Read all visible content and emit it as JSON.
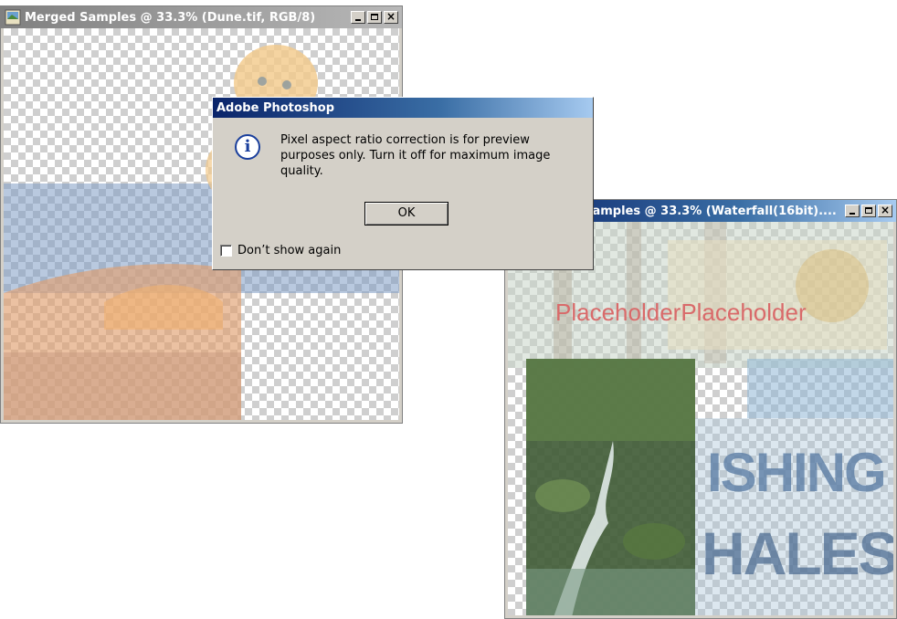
{
  "window1": {
    "title": "Merged Samples @ 33.3% (Dune.tif, RGB/8)",
    "controls": {
      "minimize": "_",
      "maximize": "□",
      "close": "✕"
    }
  },
  "window2": {
    "title": "Merged Samples @ 33.3% (Waterfall(16bit)....",
    "controls": {
      "minimize": "_",
      "maximize": "□",
      "close": "✕"
    },
    "overlay_text_1": "PlaceholderPlaceholder",
    "overlay_text_2": "ISHING",
    "overlay_text_3": "HALES"
  },
  "dialog": {
    "title": "Adobe Photoshop",
    "icon": "info-icon",
    "message": "Pixel aspect ratio correction is for preview purposes only. Turn it off for maximum image quality.",
    "ok_label": "OK",
    "checkbox_label": "Don’t show again",
    "checkbox_checked": false
  },
  "colors": {
    "active_title_start": "#0a246a",
    "active_title_end": "#a6caf0",
    "inactive_title": "#808080",
    "dialog_bg": "#d4d0c8"
  }
}
